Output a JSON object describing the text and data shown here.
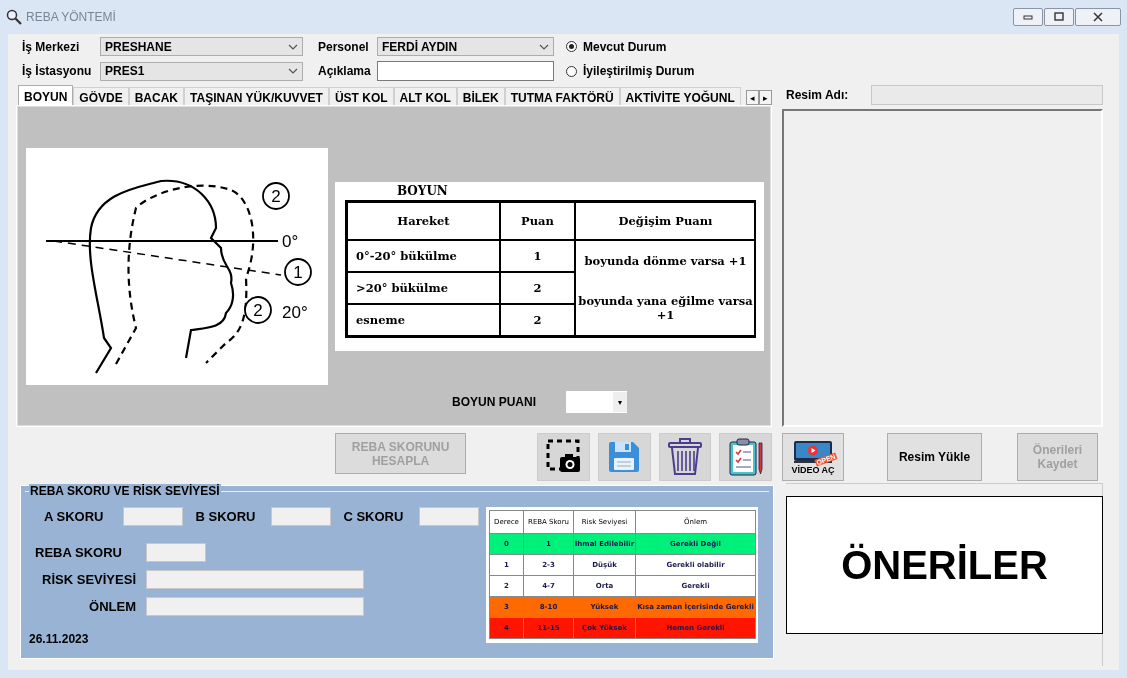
{
  "window": {
    "title": "REBA YÖNTEMİ"
  },
  "form": {
    "fields": [
      {
        "label": "İş Merkezi",
        "value": "PRESHANE",
        "kind": "dropdown"
      },
      {
        "label": "Personel",
        "value": "FERDİ AYDIN",
        "kind": "dropdown"
      },
      {
        "label": "İş İstasyonu",
        "value": "PRES1",
        "kind": "dropdown"
      },
      {
        "label": "Açıklama",
        "kind": "text"
      }
    ],
    "radios": [
      {
        "label": "Mevcut Durum",
        "selected": true
      },
      {
        "label": "İyileştirilmiş Durum",
        "selected": false
      }
    ]
  },
  "tabs": [
    {
      "label": "BOYUN",
      "selected": true
    },
    {
      "label": "GÖVDE",
      "selected": false
    },
    {
      "label": "BACAK",
      "selected": false
    },
    {
      "label": "TAŞINAN YÜK/KUVVET",
      "selected": false
    },
    {
      "label": "ÜST KOL",
      "selected": false
    },
    {
      "label": "ALT KOL",
      "selected": false
    },
    {
      "label": "BİLEK",
      "selected": false
    },
    {
      "label": "TUTMA FAKTÖRÜ",
      "selected": false
    },
    {
      "label": "AKTİVİTE YOĞUNL",
      "selected": false
    }
  ],
  "tab_scroll": [
    "◂",
    "▸"
  ],
  "neck_figure": {
    "angle_labels": [
      "0°",
      "20°"
    ],
    "position_numbers": [
      "2",
      "1",
      "2"
    ]
  },
  "neck_table": {
    "title": "BOYUN",
    "columns": [
      "Hareket",
      "Puan",
      "Değişim Puanı"
    ],
    "rows": [
      {
        "movement": "0°-20° bükülme",
        "score": "1"
      },
      {
        "movement": ">20° bükülme",
        "score": "2"
      },
      {
        "movement": "esneme",
        "score": "2"
      }
    ],
    "changes": [
      "boyunda dönme varsa +1",
      "boyunda yana eğilme varsa +1"
    ]
  },
  "score_select": {
    "label": "BOYUN PUANI",
    "caret": "▾"
  },
  "image_name": {
    "label": "Resim Adı:"
  },
  "actions": {
    "calculate": {
      "label": "REBA SKORUNU HESAPLA",
      "disabled": true
    },
    "video": {
      "label": "VİDEO AÇ",
      "badge": "OPEN"
    },
    "upload": {
      "label": "Resim Yükle",
      "disabled": false
    },
    "save_suggestions": {
      "label": "Önerileri Kaydet",
      "disabled": true
    }
  },
  "risk_panel": {
    "title": "REBA SKORU VE RİSK SEVİYESİ",
    "scores": [
      "A SKORU",
      "B SKORU",
      "C SKORU"
    ],
    "fields": [
      "REBA SKORU",
      "RİSK SEVİYESİ",
      "ÖNLEM"
    ],
    "date": "26.11.2023",
    "table": {
      "columns": [
        "Derece",
        "REBA Skoru",
        "Risk Seviyesi",
        "Önlem"
      ],
      "rows": [
        {
          "cells": [
            "0",
            "1",
            "İhmal Edilebilir",
            "Gerekli Değil"
          ],
          "color": "#00f07c"
        },
        {
          "cells": [
            "1",
            "2-3",
            "Düşük",
            "Gerekli olabilir"
          ],
          "color": "#ffffff"
        },
        {
          "cells": [
            "2",
            "4-7",
            "Orta",
            "Gerekli"
          ],
          "color": "#ffffff"
        },
        {
          "cells": [
            "3",
            "8-10",
            "Yüksek",
            "Kısa zaman İçerisinde Gerekli"
          ],
          "color": "#ff6a00"
        },
        {
          "cells": [
            "4",
            "11-15",
            "Çok Yüksek",
            "Hemen Gerekli"
          ],
          "color": "#ff1500"
        }
      ]
    }
  },
  "suggestions": {
    "title": "ÖNERİLER"
  }
}
